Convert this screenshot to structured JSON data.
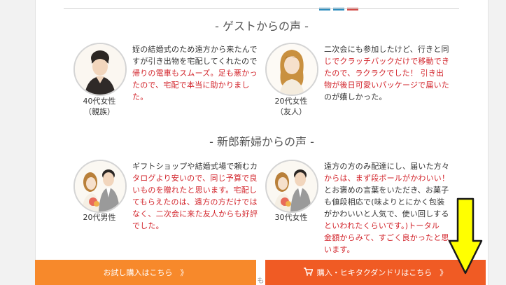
{
  "guest_section": {
    "heading": "- ゲストからの声 -",
    "voices": [
      {
        "caption_line1": "40代女性",
        "caption_line2": "（親族）",
        "text": [
          {
            "t": "姪の結婚式のため遠方から来たんで",
            "red": false
          },
          {
            "t": "すが引き出物を宅配してくれたので",
            "red": false
          },
          {
            "t": "帰りの電車もスムーズ。足も悪かっ",
            "red": true
          },
          {
            "t": "たので、宅配で本当に助かりまし",
            "red": true
          },
          {
            "t": "た。",
            "red": true
          }
        ]
      },
      {
        "caption_line1": "20代女性",
        "caption_line2": "（友人）",
        "text": [
          {
            "t": "二次会にも参加したけど、行きと同",
            "red": false
          },
          {
            "t": "じでクラッチバックだけで移動でき",
            "red": true
          },
          {
            "t": "たので、ラクラクでした！ 引き出",
            "red": true
          },
          {
            "t": "物が後日可愛いパッケージで届いた",
            "red": true
          },
          {
            "t": "のが嬉しかった。",
            "red": false
          }
        ]
      }
    ]
  },
  "couple_section": {
    "heading": "- 新郎新婦からの声 -",
    "voices": [
      {
        "caption_line1": "20代男性",
        "caption_line2": "",
        "text": [
          {
            "t": "ギフトショップや結婚式場で頼むカ",
            "red": false
          },
          {
            "t": "タログより安いので、同じ予算で良",
            "red": true
          },
          {
            "t": "いものを贈れたと思います。宅配し",
            "red": true
          },
          {
            "t": "てもらえたのは、遠方の方だけでは",
            "red": true
          },
          {
            "t": "なく、二次会に来た友人からも好評",
            "red": true
          },
          {
            "t": "でした。",
            "red": true
          }
        ]
      },
      {
        "caption_line1": "30代女性",
        "caption_line2": "",
        "text": [
          {
            "t": "遠方の方のみ配達にし、届いた方々",
            "red": false
          },
          {
            "t": "からは、まず段ボールがかわいい！",
            "red": true
          },
          {
            "t": "とお褒めの言葉をいただき、お菓子",
            "red": false
          },
          {
            "t": "も値段相応で(味よりとにかく包装",
            "red": false
          },
          {
            "t": "がかわいいと人気で、使い回しする",
            "red": false
          },
          {
            "t": "といわれたくらいです。)トータル",
            "red": true
          },
          {
            "t": "金額からみて、すごく良かったと思",
            "red": true
          },
          {
            "t": "います。",
            "red": true
          }
        ]
      }
    ]
  },
  "buttons": {
    "trial": "お試し購入はこちら　》",
    "purchase": "購入・ヒキタクダンドリはこちら　》"
  },
  "peek_text": "も",
  "colors": {
    "accent_red": "#d2232a",
    "trial_button": "#f7892b",
    "purchase_button": "#f05b24",
    "arrow": "#ffff00"
  }
}
